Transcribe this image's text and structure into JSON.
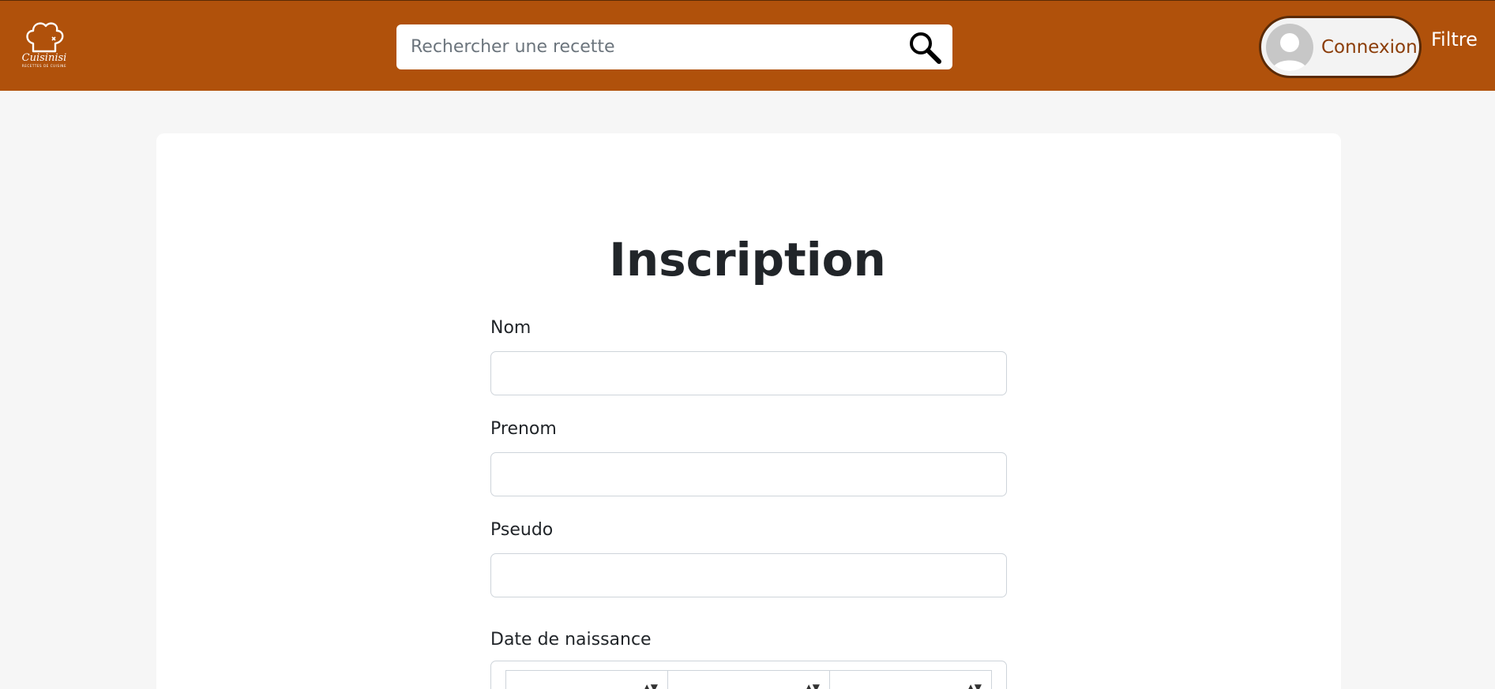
{
  "header": {
    "logo": {
      "name": "Cuisinisi",
      "tagline": "RECETTES DE CUISINE"
    },
    "search": {
      "placeholder": "Rechercher une recette",
      "value": ""
    },
    "login": {
      "label": "Connexion"
    },
    "filter": {
      "label": "Filtre"
    }
  },
  "form": {
    "title": "Inscription",
    "fields": [
      {
        "label": "Nom",
        "value": ""
      },
      {
        "label": "Prenom",
        "value": ""
      },
      {
        "label": "Pseudo",
        "value": ""
      }
    ],
    "birthdate": {
      "label": "Date de naissance"
    }
  },
  "colors": {
    "brand": "#b0510b",
    "brand_dark": "#5a2a05",
    "page_background": "#f6f6f6"
  },
  "icons": [
    "chef-hat-logo-icon",
    "search-icon",
    "user-avatar-icon",
    "chevron-down-icon"
  ]
}
